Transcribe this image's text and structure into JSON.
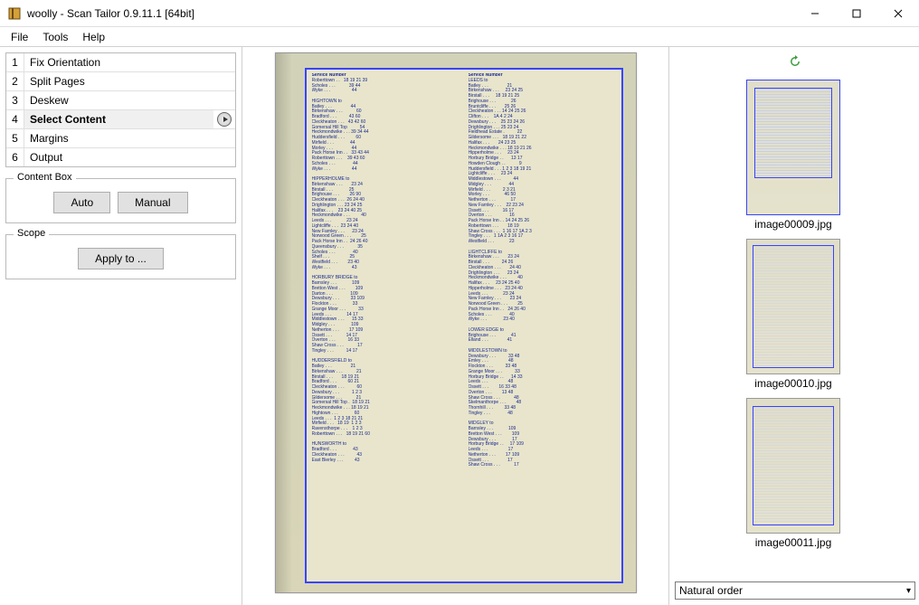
{
  "window": {
    "title": "woolly - Scan Tailor 0.9.11.1 [64bit]"
  },
  "menubar": [
    "File",
    "Tools",
    "Help"
  ],
  "stages": [
    {
      "num": "1",
      "label": "Fix Orientation"
    },
    {
      "num": "2",
      "label": "Split Pages"
    },
    {
      "num": "3",
      "label": "Deskew"
    },
    {
      "num": "4",
      "label": "Select Content",
      "selected": true,
      "play": true
    },
    {
      "num": "5",
      "label": "Margins"
    },
    {
      "num": "6",
      "label": "Output"
    }
  ],
  "content_box": {
    "legend": "Content Box",
    "auto_label": "Auto",
    "manual_label": "Manual"
  },
  "scope": {
    "legend": "Scope",
    "apply_label": "Apply to ..."
  },
  "scan": {
    "left_header": "Service Number",
    "right_header": "Service Number",
    "left_text": "Roberttown . .   18 19 21 39\nScholes . . .           39 44\nWyke . . .                 44\n\nHIGHTOWN to\nBatley . . .               44\nBirkenshaw . . .           60\nBradford . . .          43 60\nCleckheaton . . .   43 42 60\nGomersal Hill Top          54\nHeckmondwike . . . 39 34 44\nHuddersfield . . .         60\nMirfield . . .             44\nMorley . . .               44\nPack Horse Inn . .   33 43 44\nRoberttown . . .    39 43 60\nScholes . . .              44\nWyke . . .                 44\n\nHIPPERHOLME to\nBirkenshaw . . .       23 24\nBirstall . . .             25\nBrighouse . . .        26 90\nCleckheaton . . .  26 24 40\nDrighlington . . . 23 24 25\nHalifax . . .    23 24 40 25\nHeckmondwike . . .         40\nLeeds . . .            23 24\nLightcliffe . . .  23 24 40\nNew Farnley . . .      23 24\nNorwood Green . . .        25\nPack Horse Inn . .  24 26 40\nQueensbury . . .           35\nScholes . . .              40\nShelf . . .                25\nWestfield . . .        23 40\nWyke . . .                 43\n\nHORBURY BRIDGE to\nBarnsley . . .            109\nBretton West . . .        109\nDarton . . .              109\nDewsbury . . .         33 109\nFlockton . . .             33\nGrange Moor . . .          33\nLeeds . . .            14 17\nMiddlestown . . .      15 33\nMidgley . . .             109\nNetherton . . .        17 109\nOssett . . .           14 17\nOverton . . .          16 33\nShaw Cross . . .           17\nTingley . . .          14 17\n\nHUDDERSFIELD to\nBatley . . .               21\nBirkenshaw . . .           21\nBirstall . . .       18 19 21\nBradford . . .         60 21\nCleckheaton . . .          60\nDewsbury . . .          1 2 3\nGildersome . . .           21\nGomersal Hill Top .  18 19 21\nHeckmondwike . . . 18 19 21\nHightown . . .             60\nLeeds . . .  1 2 3 18 21 21\nMirfield . . .   18 19  1 2 3\nRavensthorpe . . .    1 2 3\nRoberttown . . .   18 19 21 60\n\nHUNSWORTH to\nBradford . . .             43\nCleckheaton . . .          43\nEast Bierley . . .         43\n",
    "right_text": "LEEDS to\nBatley . . .               21\nBirkenshaw . . .     23 24 25\nBirstall . . .     18 19 21 25\nBrighouse . . .            26\nBruntcliffe . . .       25 26\nCleckheaton . . . 14 24 25 26\nClifton . . .    1A 4 2 24\nDewsbury . . .    25 23 24 26\nDrighlington . . . 25 23 24\nFieldhead Estate .          22\nGildersome . . .   18 19 21 22\nHalifax . . .       24 23 25\nHeckmondwike . . . 18 19 21 26\nHipperholme . . .     23 24\nHorbury Bridge . .      13 17\nHowden Clough . .           9\nHuddersfield . . . 1 2 3 18 19 21\nLightcliffe . . .     23 24\nMiddlestown . . .          44\nMidgley . . .              44\nMirfield . . .          2 3 21\nMorley . . .            46 50\nNetherton . . .            17\nNew Farnley . . .    22 23 24\nOssett . . .           16 17\nOverton . . .              16\nPack Horse Inn . . 14 24 25 26\nRoberttown . . .       18 19\nShaw Cross . . .  1 16 17 1A 2 3\nTingley . . .   1 1A 2 3 16 17\nWestfield . . .            23\n\nLIGHTCLIFFE to\nBirkenshaw . . .       23 24\nBirstall . . .          24 26\nCleckheaton . . .       24 40\nDrighlington . . .      23 24\nHeckmondwike . . .         40\nHalifax . . .     23 24 25 40\nHipperholme . . .   23 24 40\nLeeds . . .            23 24\nNew Farnley . . .       23 24\nNorwood Green . . .        25\nPack Horse Inn . .   24 26 40\nScholes . . .              40\nWyke . . .             23 40\n\nLOWER EDGE to\nBrighouse . . .            41\nElland . . .               41\n\nMIDDLESTOWN to\nDewsbury . . .          33 48\nEmley . . .                48\nFlockton . . .          33 48\nGrange Moor . . .          33\nHorbury Bridge . .      14 33\nLeeds . . .                48\nOssett . . .        16 33 48\nOverton . . .        13 48\nShaw Cross . . .           48\nSkelmanthorpe . . .        48\nThornhill . . .         33 48\nTingley . . .              48\n\nMIDGLEY to\nBarnsley . . .            109\nBretton West . . .        109\nDewsbury . . .             17\nHorbury Bridge . .     17 109\nLeeds . . .                17\nNetherton . . .        17 109\nOssett . . .               17\nShaw Cross . . .           17"
  },
  "thumbnails": [
    {
      "label": "image00009.jpg"
    },
    {
      "label": "image00010.jpg"
    },
    {
      "label": "image00011.jpg"
    }
  ],
  "sort": {
    "selected": "Natural order"
  }
}
